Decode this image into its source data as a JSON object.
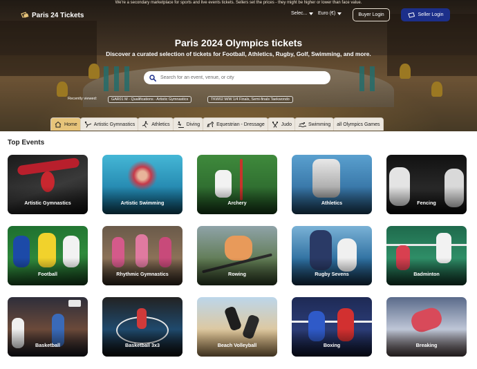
{
  "header": {
    "top_note": "We're a secondary marketplace for sports and live events tickets. Sellers set the prices - they might be higher or lower than face value.",
    "logo_text": "Paris 24 Tickets",
    "language_select": "Selec...",
    "currency_select": "Euro (€)",
    "buyer_login": "Buyer Login",
    "seller_login": "Seller Login"
  },
  "hero": {
    "title": "Paris 2024 Olympics tickets",
    "subtitle": "Discover a curated selection of tickets for Football, Athletics, Rugby, Golf, Swimming, and more.",
    "search_placeholder": "Search for an event, venue, or city",
    "recently_viewed_label": "Recently viewed:",
    "recent_items": [
      "GAR01 M - Qualifications - Artistic Gymnastics",
      "TKW02 M/W 1/4 Finals, Semi-finals Taekwondo"
    ]
  },
  "tabs": [
    {
      "label": "Home",
      "icon": "home-icon",
      "active": true
    },
    {
      "label": "Artistic Gymnastics",
      "icon": "gymnastics-icon",
      "active": false
    },
    {
      "label": "Athletics",
      "icon": "running-icon",
      "active": false
    },
    {
      "label": "Diving",
      "icon": "diving-icon",
      "active": false
    },
    {
      "label": "Equestrian - Dressage",
      "icon": "horse-icon",
      "active": false
    },
    {
      "label": "Judo",
      "icon": "judo-icon",
      "active": false
    },
    {
      "label": "Swimming",
      "icon": "swimming-icon",
      "active": false
    },
    {
      "label": "all Olympics Games",
      "icon": "",
      "active": false
    }
  ],
  "top_events": {
    "title": "Top Events",
    "events": [
      "Artistic Gymnastics",
      "Artistic Swimming",
      "Archery",
      "Athletics",
      "Fencing",
      "Football",
      "Rhythmic Gymnastics",
      "Rowing",
      "Rugby Sevens",
      "Badminton",
      "Basketball",
      "Basketball 3x3",
      "Beach Volleyball",
      "Boxing",
      "Breaking"
    ]
  },
  "colors": {
    "accent_tab": "#e7c47a",
    "seller_button": "#1c2f8a",
    "search_icon": "#1c2f8a"
  }
}
